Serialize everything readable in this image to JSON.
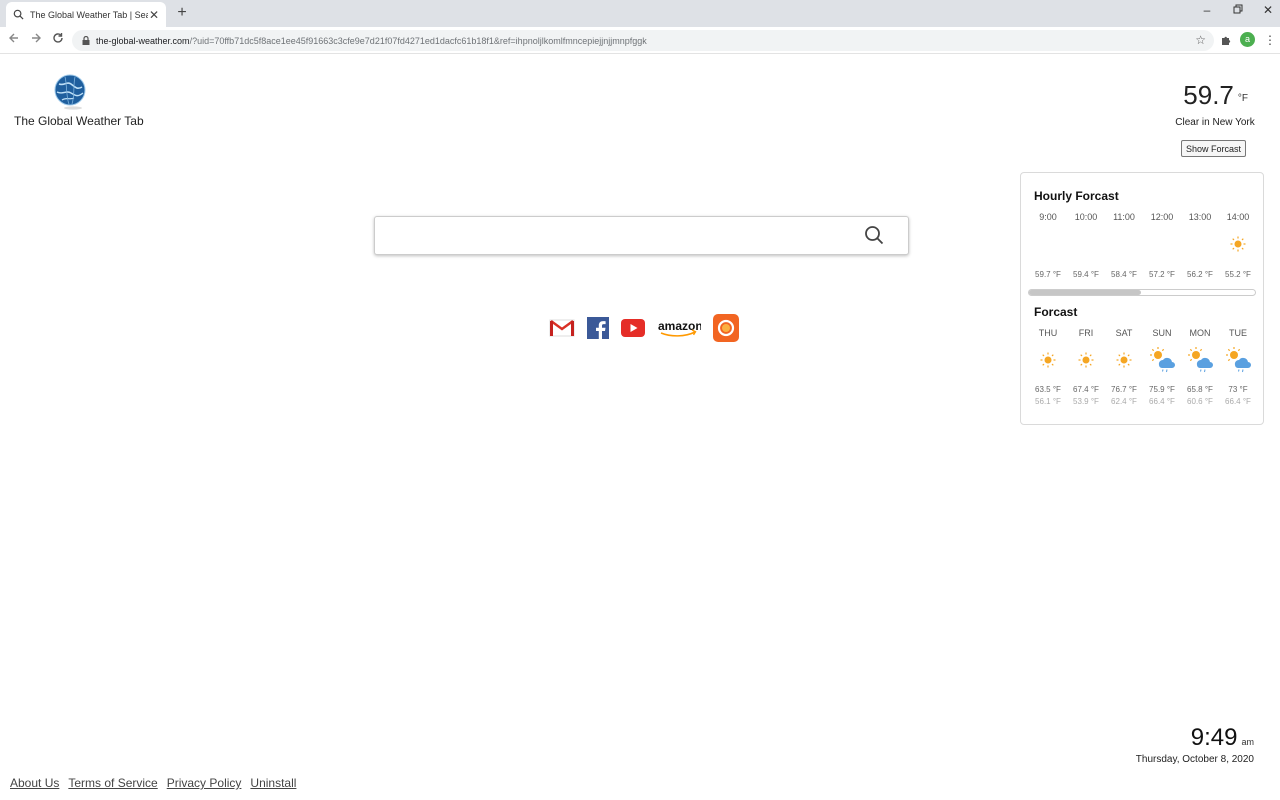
{
  "browser": {
    "tab_title": "The Global Weather Tab | Search",
    "tab_close": "✕",
    "new_tab": "+",
    "url_host": "the-global-weather.com",
    "url_rest": "/?uid=70ffb71dc5f8ace1ee45f91663c3cfe9e7d21f07fd4271ed1dacfc61b18f1&ref=ihpnoljlkomlfmncepiejjnjjmnpfggk",
    "avatar_letter": "a"
  },
  "logo": {
    "text": "The Global Weather Tab"
  },
  "current_weather": {
    "temp": "59.7",
    "unit": "°F",
    "condition": "Clear in New York",
    "show_button": "Show Forcast",
    "icon": "moon-icon"
  },
  "hourly": {
    "title": "Hourly Forcast",
    "items": [
      {
        "time": "9:00",
        "icon": "moon-icon",
        "temp": "59.7 °F"
      },
      {
        "time": "10:00",
        "icon": "moon-icon",
        "temp": "59.4 °F"
      },
      {
        "time": "11:00",
        "icon": "moon-icon",
        "temp": "58.4 °F"
      },
      {
        "time": "12:00",
        "icon": "moon-icon",
        "temp": "57.2 °F"
      },
      {
        "time": "13:00",
        "icon": "moon-icon",
        "temp": "56.2 °F"
      },
      {
        "time": "14:00",
        "icon": "sun-icon",
        "temp": "55.2 °F"
      }
    ]
  },
  "daily": {
    "title": "Forcast",
    "items": [
      {
        "day": "THU",
        "icon": "sun-icon",
        "high": "63.5 °F",
        "low": "56.1 °F"
      },
      {
        "day": "FRI",
        "icon": "sun-icon",
        "high": "67.4 °F",
        "low": "53.9 °F"
      },
      {
        "day": "SAT",
        "icon": "sun-icon",
        "high": "76.7 °F",
        "low": "62.4 °F"
      },
      {
        "day": "SUN",
        "icon": "sun-rain-icon",
        "high": "75.9 °F",
        "low": "66.4 °F"
      },
      {
        "day": "MON",
        "icon": "sun-rain-icon",
        "high": "65.8 °F",
        "low": "60.6 °F"
      },
      {
        "day": "TUE",
        "icon": "sun-rain-icon",
        "high": "73 °F",
        "low": "66.4 °F"
      }
    ]
  },
  "search": {
    "placeholder": ""
  },
  "quicklinks": {
    "amazon_label": "amazon",
    "items": [
      "gmail-icon",
      "facebook-icon",
      "youtube-icon",
      "amazon-icon",
      "weather-app-icon"
    ]
  },
  "clock": {
    "time": "9:49",
    "ampm": "am",
    "date": "Thursday, October 8, 2020"
  },
  "footer": {
    "about": "About Us",
    "terms": "Terms of Service",
    "privacy": "Privacy Policy",
    "uninstall": "Uninstall"
  },
  "colors": {
    "sun": "#f5a623",
    "cloud": "#5aa0e0",
    "accent": "#1a73e8"
  }
}
